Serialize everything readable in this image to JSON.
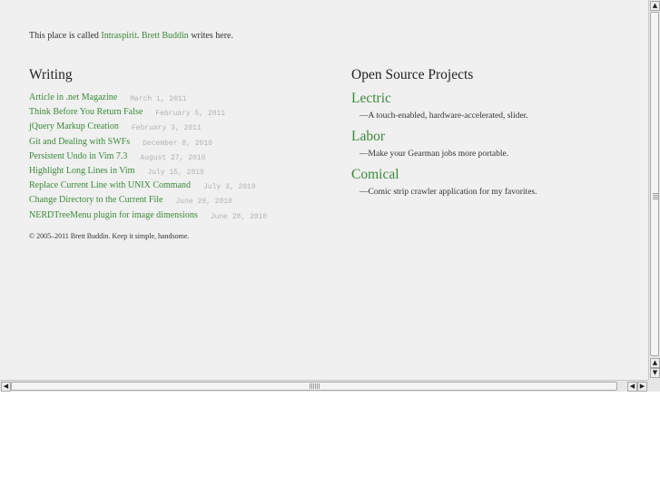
{
  "intro": {
    "prefix": "This place is called ",
    "site_name": "Intraspirit",
    "separator": ". ",
    "author_name": "Brett Buddin",
    "suffix": " writes here."
  },
  "writing": {
    "heading": "Writing",
    "articles": [
      {
        "title": "Article in .net Magazine",
        "date": "March 1, 2011"
      },
      {
        "title": "Think Before You Return False",
        "date": "February 5, 2011"
      },
      {
        "title": "jQuery Markup Creation",
        "date": "February 3, 2011"
      },
      {
        "title": "Git and Dealing with SWFs",
        "date": "December 8, 2010"
      },
      {
        "title": "Persistent Undo in Vim 7.3",
        "date": "August 27, 2010"
      },
      {
        "title": "Highlight Long Lines in Vim",
        "date": "July 15, 2010"
      },
      {
        "title": "Replace Current Line with UNIX Command",
        "date": "July 3, 2010"
      },
      {
        "title": "Change Directory to the Current File",
        "date": "June 29, 2010"
      },
      {
        "title": "NERDTreeMenu plugin for image dimensions",
        "date": "June 28, 2010"
      }
    ]
  },
  "footer": {
    "text": "© 2005–2011 Brett Buddin. Keep it simple, handsome."
  },
  "projects": {
    "heading": "Open Source Projects",
    "items": [
      {
        "name": "Lectric",
        "description": "—A touch-enabled, hardware-accelerated, slider."
      },
      {
        "name": "Labor",
        "description": "—Make your Gearman jobs more portable."
      },
      {
        "name": "Comical",
        "description": "—Comic strip crawler application for my favorites."
      }
    ]
  },
  "scrollbars": {
    "up_arrow": "▲",
    "down_arrow": "▼",
    "left_arrow": "◀",
    "right_arrow": "▶"
  },
  "colors": {
    "link": "#3a8a3a",
    "text": "#333333",
    "date": "#b3b3b3",
    "background": "#f0f0f0"
  }
}
